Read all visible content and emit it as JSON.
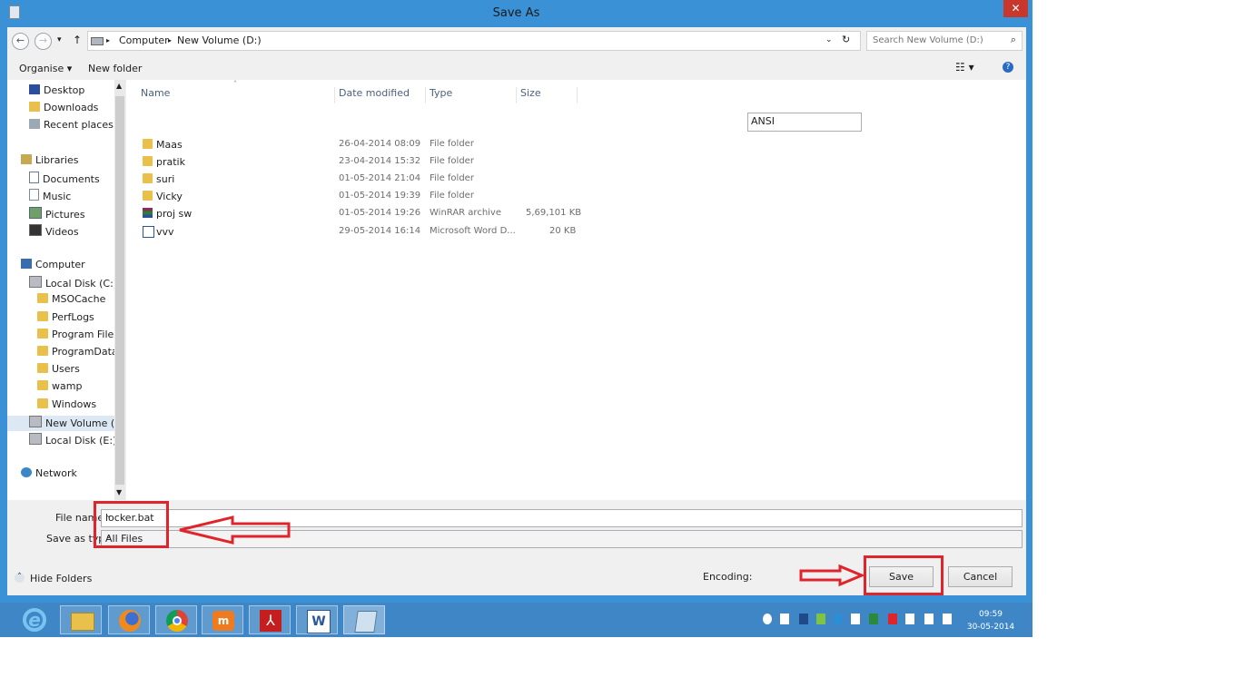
{
  "window": {
    "title": "Save As",
    "close_glyph": "✕"
  },
  "nav": {
    "back_glyph": "←",
    "forward_glyph": "→",
    "recent_glyph": "▾",
    "up_glyph": "↑",
    "breadcrumb": [
      "Computer",
      "New Volume (D:)"
    ],
    "refresh_glyph": "↻",
    "search_placeholder": "Search New Volume (D:)"
  },
  "toolbar": {
    "organise": "Organise ▾",
    "new_folder": "New folder"
  },
  "sidebar": {
    "items": [
      {
        "label": "Desktop",
        "icon": "desktop-icon"
      },
      {
        "label": "Downloads",
        "icon": "downloads-icon"
      },
      {
        "label": "Recent places",
        "icon": "recent-places-icon"
      },
      {
        "label": "Libraries",
        "icon": "libraries-icon"
      },
      {
        "label": "Documents",
        "icon": "documents-icon"
      },
      {
        "label": "Music",
        "icon": "music-icon"
      },
      {
        "label": "Pictures",
        "icon": "pictures-icon"
      },
      {
        "label": "Videos",
        "icon": "videos-icon"
      },
      {
        "label": "Computer",
        "icon": "computer-icon"
      },
      {
        "label": "Local Disk (C:)",
        "icon": "drive-icon"
      },
      {
        "label": "MSOCache",
        "icon": "folder-icon"
      },
      {
        "label": "PerfLogs",
        "icon": "folder-icon"
      },
      {
        "label": "Program Files",
        "icon": "folder-icon"
      },
      {
        "label": "ProgramData",
        "icon": "folder-icon"
      },
      {
        "label": "Users",
        "icon": "folder-icon"
      },
      {
        "label": "wamp",
        "icon": "folder-icon"
      },
      {
        "label": "Windows",
        "icon": "folder-icon"
      },
      {
        "label": "New Volume (D:)",
        "icon": "drive-icon"
      },
      {
        "label": "Local Disk (E:)",
        "icon": "drive-icon"
      },
      {
        "label": "Network",
        "icon": "network-icon"
      }
    ]
  },
  "files": {
    "columns": [
      "Name",
      "Date modified",
      "Type",
      "Size"
    ],
    "rows": [
      {
        "name": "Maas",
        "date": "26-04-2014 08:09",
        "type": "File folder",
        "size": "",
        "icon": "folder-icon"
      },
      {
        "name": "pratik",
        "date": "23-04-2014 15:32",
        "type": "File folder",
        "size": "",
        "icon": "folder-icon"
      },
      {
        "name": "suri",
        "date": "01-05-2014 21:04",
        "type": "File folder",
        "size": "",
        "icon": "folder-icon"
      },
      {
        "name": "Vicky",
        "date": "01-05-2014 19:39",
        "type": "File folder",
        "size": "",
        "icon": "folder-icon"
      },
      {
        "name": "proj sw",
        "date": "01-05-2014 19:26",
        "type": "WinRAR archive",
        "size": "5,69,101 KB",
        "icon": "winrar-icon"
      },
      {
        "name": "vvv",
        "date": "29-05-2014 16:14",
        "type": "Microsoft Word D...",
        "size": "20 KB",
        "icon": "word-doc-icon"
      }
    ]
  },
  "form": {
    "file_name_label": "File name:",
    "file_name_value": "locker.bat",
    "save_type_label": "Save as type:",
    "save_type_value": "All Files",
    "hide_folders": "Hide Folders",
    "encoding_label": "Encoding:",
    "encoding_value": "ANSI",
    "save": "Save",
    "cancel": "Cancel"
  },
  "taskbar": {
    "apps": [
      "internet-explorer-icon",
      "file-explorer-icon",
      "firefox-icon",
      "chrome-icon",
      "micromax-icon",
      "acrobat-icon",
      "word-icon",
      "notepad-icon"
    ],
    "time": "09:59",
    "date": "30-05-2014"
  },
  "colors": {
    "annotation": "#e0242b",
    "title_bar": "#3a91d6",
    "taskbar": "#3e86c6"
  }
}
